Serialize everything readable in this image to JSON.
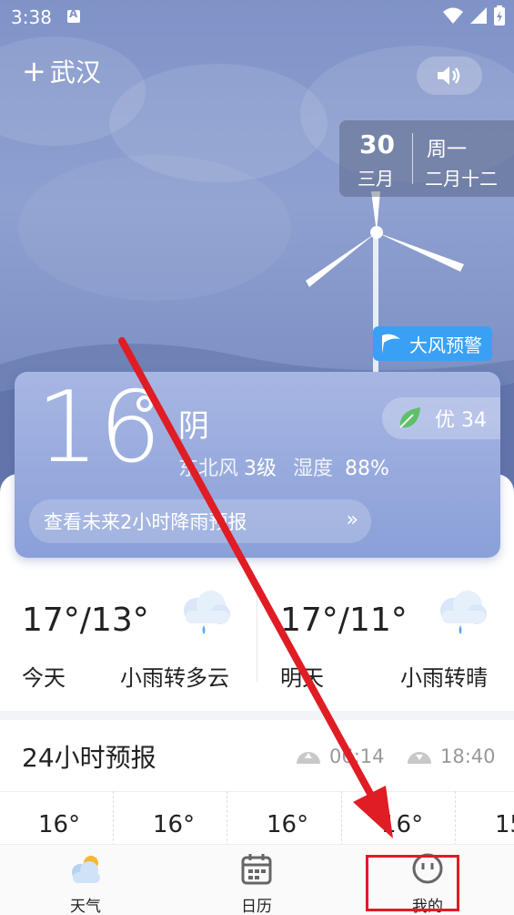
{
  "status_bar": {
    "time": "3:38"
  },
  "header": {
    "city": "武汉",
    "add_symbol": "+"
  },
  "date_box": {
    "day": "30",
    "month": "三月",
    "weekday": "周一",
    "lunar": "二月十二"
  },
  "alert": {
    "label": "大风预警"
  },
  "current": {
    "temperature": "16",
    "condition": "阴",
    "aqi_label": "优 34",
    "wind": "东北风",
    "wind_level": "3级",
    "humidity_label": "湿度",
    "humidity": "88%",
    "rain_forecast": "查看未来2小时降雨预报",
    "chevron": "»"
  },
  "forecast": [
    {
      "temp": "17°/13°",
      "day": "今天",
      "desc": "小雨转多云"
    },
    {
      "temp": "17°/11°",
      "day": "明天",
      "desc": "小雨转晴"
    }
  ],
  "hourly": {
    "title": "24小时预报",
    "sunrise": "06:14",
    "sunset": "18:40",
    "temps": [
      "16°",
      "16°",
      "16°",
      "16°",
      "15"
    ]
  },
  "nav": [
    {
      "label": "天气",
      "icon": "weather-icon"
    },
    {
      "label": "日历",
      "icon": "calendar-icon"
    },
    {
      "label": "我的",
      "icon": "face-icon"
    }
  ],
  "colors": {
    "accent": "#3aa0f5",
    "highlight": "#e01c24",
    "hero": "#7f93c8"
  }
}
